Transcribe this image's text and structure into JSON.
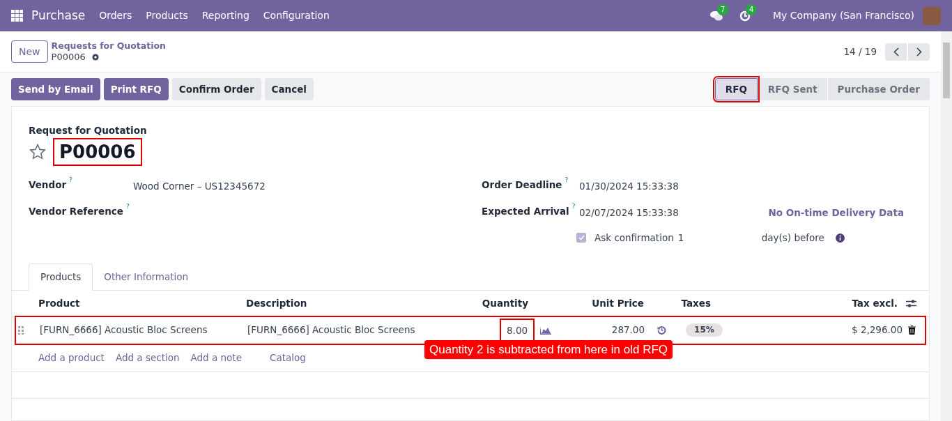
{
  "navbar": {
    "app": "Purchase",
    "menu": [
      "Orders",
      "Products",
      "Reporting",
      "Configuration"
    ],
    "messages_count": "7",
    "activities_count": "4",
    "company": "My Company (San Francisco)"
  },
  "control_panel": {
    "new_button": "New",
    "breadcrumb": "Requests for Quotation",
    "record": "P00006",
    "pager": "14 / 19"
  },
  "actions": [
    {
      "label": "Send by Email",
      "kind": "primary"
    },
    {
      "label": "Print RFQ",
      "kind": "primary"
    },
    {
      "label": "Confirm Order",
      "kind": "secondary"
    },
    {
      "label": "Cancel",
      "kind": "secondary"
    }
  ],
  "stages": [
    {
      "label": "RFQ",
      "selected": true,
      "highlighted": true
    },
    {
      "label": "RFQ Sent",
      "selected": false,
      "highlighted": false
    },
    {
      "label": "Purchase Order",
      "selected": false,
      "highlighted": false
    }
  ],
  "form": {
    "subtitle": "Request for Quotation",
    "name": "P00006",
    "name_highlighted": true,
    "favorite": false,
    "left_fields": [
      {
        "label": "Vendor",
        "help": "?",
        "value": "Wood Corner – US12345672"
      },
      {
        "label": "Vendor Reference",
        "help": "?"
      }
    ],
    "right_fields": [
      {
        "label": "Order Deadline",
        "help": "?",
        "value": "01/30/2024 15:33:38"
      },
      {
        "label": "Expected Arrival",
        "help": "?",
        "value": "02/07/2024 15:33:38",
        "note": "No On-time Delivery Data"
      }
    ],
    "ask_confirmation": {
      "checked": true,
      "label": "Ask confirmation",
      "days": "1",
      "suffix": "day(s) before"
    }
  },
  "tabs": [
    {
      "label": "Products",
      "selected": true
    },
    {
      "label": "Other Information",
      "selected": false
    }
  ],
  "table": {
    "columns": [
      "Product",
      "Description",
      "Quantity",
      "Unit Price",
      "Taxes",
      "Tax excl."
    ],
    "rows": [
      {
        "product": "[FURN_6666] Acoustic Bloc Screens",
        "description": "[FURN_6666] Acoustic Bloc Screens",
        "quantity": "8.00",
        "unit_price": "287.00",
        "taxes": "15%",
        "tax_excl": "$ 2,296.00",
        "highlighted": true,
        "quantity_highlighted": true
      }
    ],
    "add_links": [
      "Add a product",
      "Add a section",
      "Add a note",
      "Catalog"
    ]
  },
  "callout": "Quantity 2 is subtracted from here in old RFQ"
}
